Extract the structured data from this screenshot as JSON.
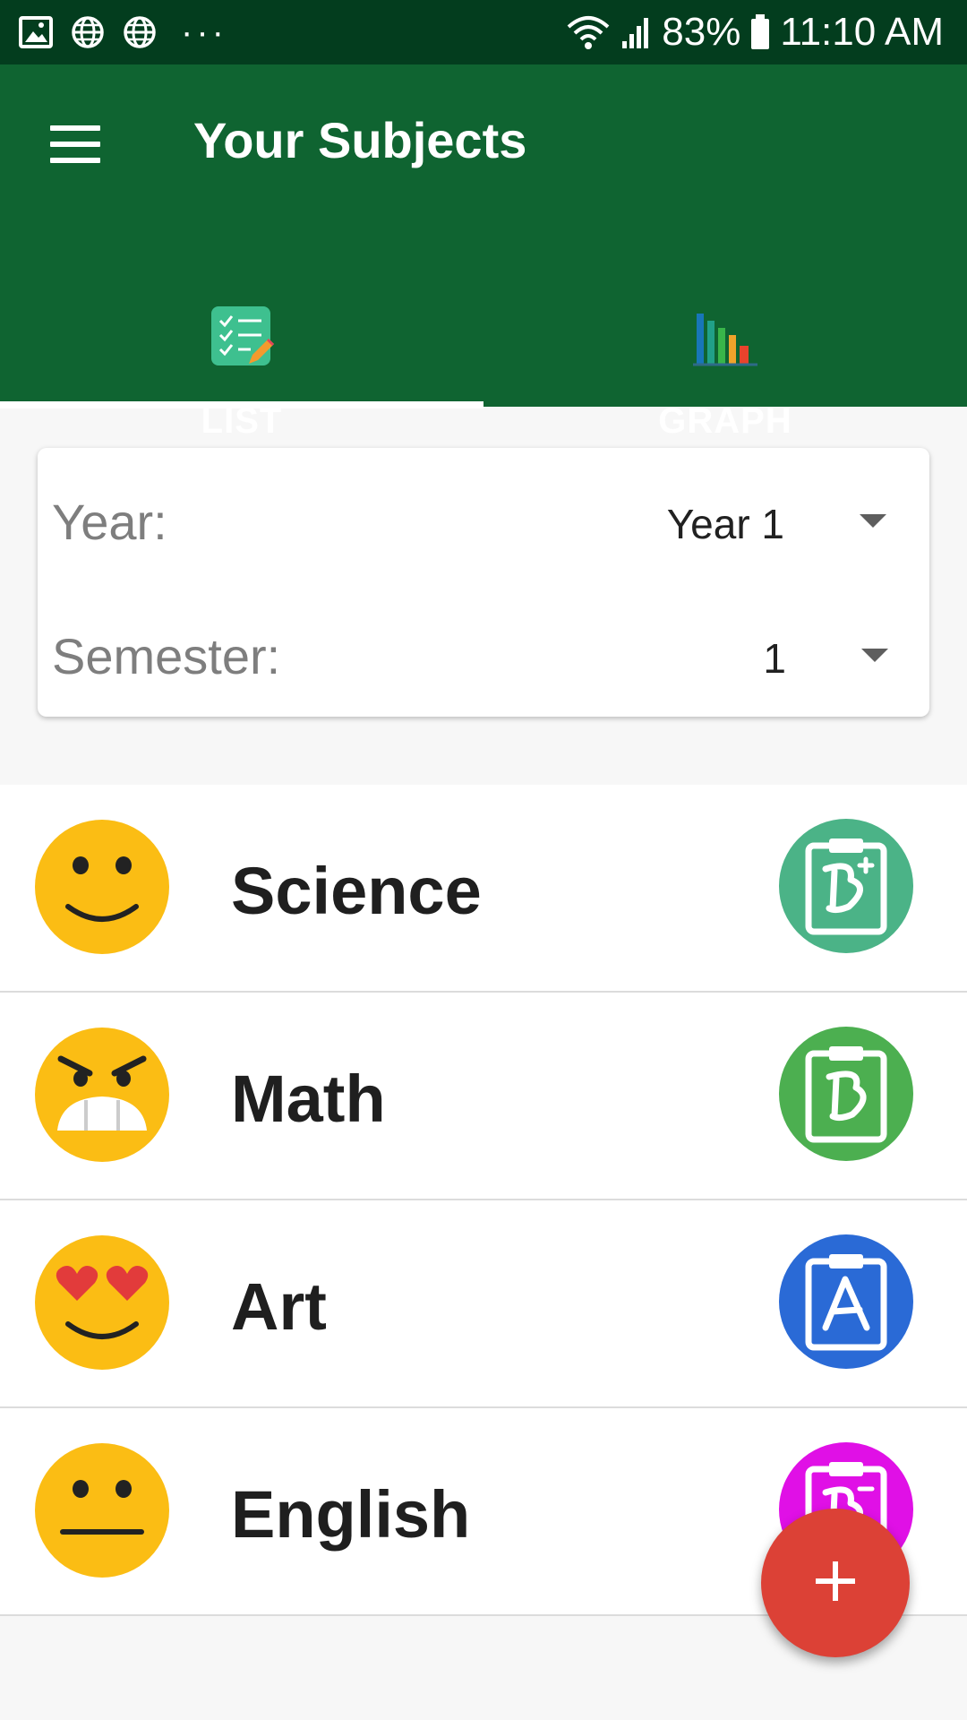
{
  "status_bar": {
    "battery": "83%",
    "time": "11:10 AM"
  },
  "app_bar": {
    "title": "Your Subjects"
  },
  "tabs": [
    {
      "label": "LIST",
      "icon": "checklist-icon",
      "selected": true
    },
    {
      "label": "GRAPH",
      "icon": "bar-chart-icon",
      "selected": false
    }
  ],
  "filters": {
    "year": {
      "label": "Year:",
      "value": "Year 1"
    },
    "semester": {
      "label": "Semester:",
      "value": "1"
    }
  },
  "subjects": [
    {
      "name": "Science",
      "mood": "smiling-face",
      "grade": "B+",
      "grade_color": "#4bb387"
    },
    {
      "name": "Math",
      "mood": "grimacing-angry-face",
      "grade": "B",
      "grade_color": "#4caf50"
    },
    {
      "name": "Art",
      "mood": "heart-eyes-face",
      "grade": "A",
      "grade_color": "#2a6ad6"
    },
    {
      "name": "English",
      "mood": "neutral-face",
      "grade": "B-",
      "grade_color": "#e010e6"
    }
  ],
  "fab": {
    "icon": "plus-icon"
  },
  "colors": {
    "status_bar": "#033d1e",
    "app_bar": "#0f6431",
    "fab": "#dc4136",
    "emoji": "#fbbd14"
  }
}
